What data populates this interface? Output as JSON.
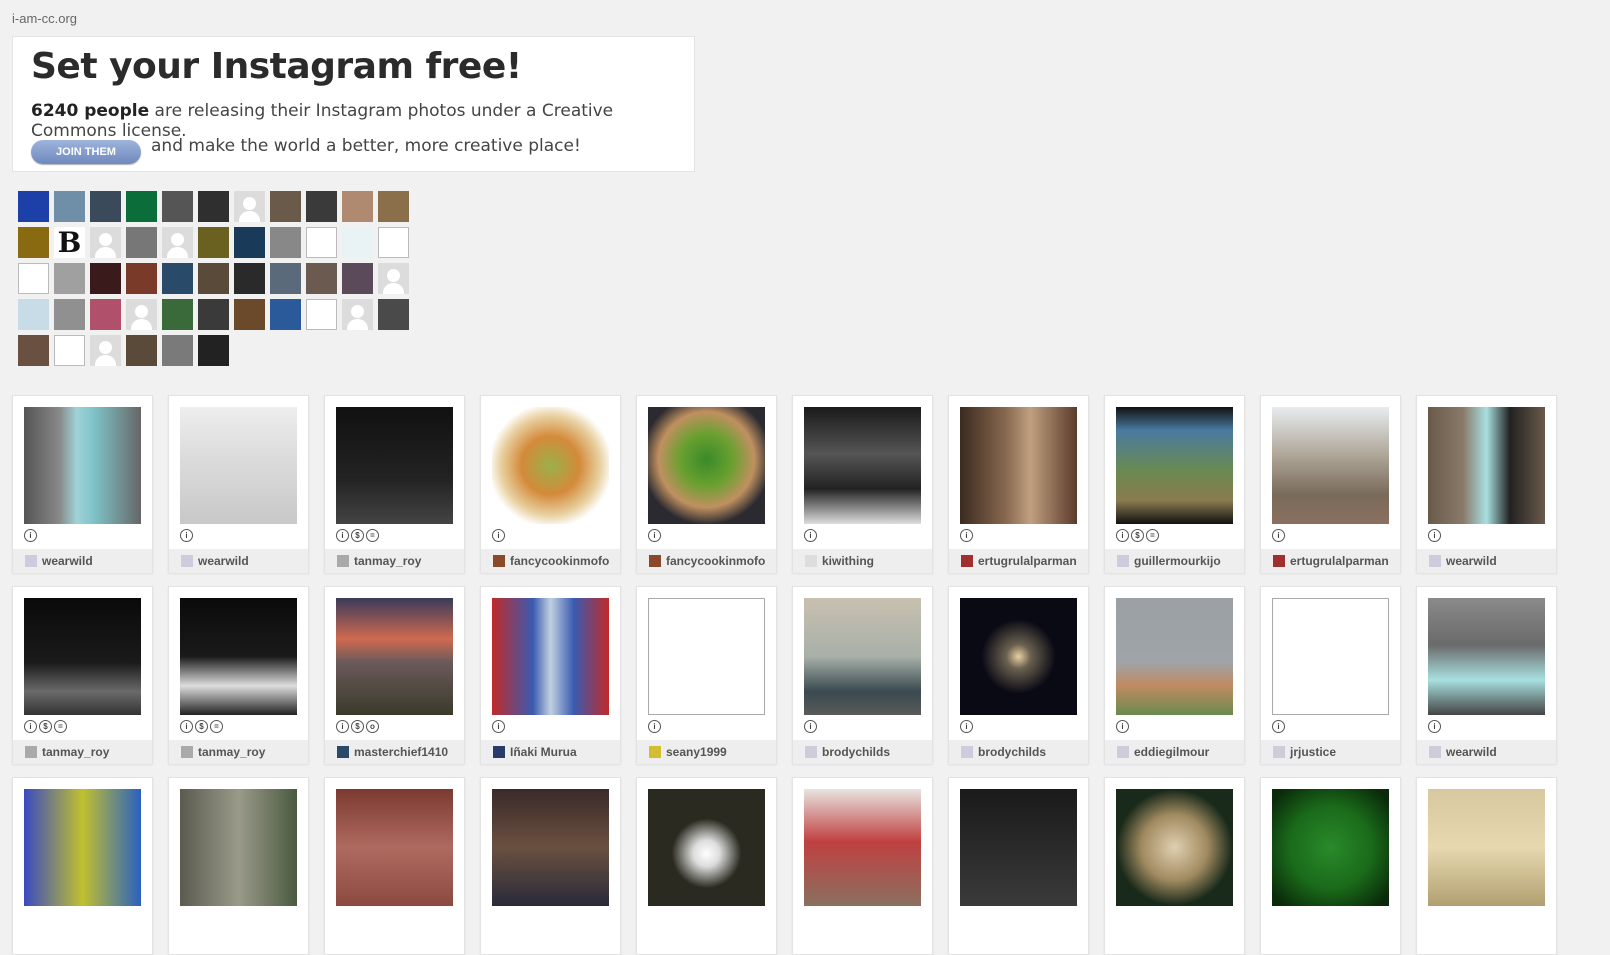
{
  "site": {
    "name": "i-am-cc.org"
  },
  "hero": {
    "title": "Set your Instagram free!",
    "count": "6240 people",
    "line1_rest": " are releasing their Instagram photos under a Creative Commons license.",
    "join_label": "JOIN THEM",
    "line2": "and make the world a better, more creative place!"
  },
  "avatars": [
    {
      "kind": "photo",
      "color": "#1c3fa8"
    },
    {
      "kind": "photo",
      "color": "#6f8fa8"
    },
    {
      "kind": "photo",
      "color": "#3b4a5a"
    },
    {
      "kind": "photo",
      "color": "#0b6e3a"
    },
    {
      "kind": "photo",
      "color": "#555555"
    },
    {
      "kind": "photo",
      "color": "#2f2f2f"
    },
    {
      "kind": "default"
    },
    {
      "kind": "photo",
      "color": "#6a5a4a"
    },
    {
      "kind": "photo",
      "color": "#3a3a3a"
    },
    {
      "kind": "photo",
      "color": "#b08a70"
    },
    {
      "kind": "photo",
      "color": "#8a6f4a"
    },
    {
      "kind": "photo",
      "color": "#8a6a10"
    },
    {
      "kind": "letter",
      "text": "B"
    },
    {
      "kind": "default"
    },
    {
      "kind": "photo",
      "color": "#777777"
    },
    {
      "kind": "default"
    },
    {
      "kind": "photo",
      "color": "#6a6020"
    },
    {
      "kind": "photo",
      "color": "#1a3a5a"
    },
    {
      "kind": "photo",
      "color": "#888888"
    },
    {
      "kind": "broken"
    },
    {
      "kind": "photo",
      "color": "#e9f2f4"
    },
    {
      "kind": "broken"
    },
    {
      "kind": "broken"
    },
    {
      "kind": "photo",
      "color": "#a0a0a0"
    },
    {
      "kind": "photo",
      "color": "#3a1a1a"
    },
    {
      "kind": "photo",
      "color": "#7a3a2a"
    },
    {
      "kind": "photo",
      "color": "#2a4a6a"
    },
    {
      "kind": "photo",
      "color": "#5a4a3a"
    },
    {
      "kind": "photo",
      "color": "#2a2a2a"
    },
    {
      "kind": "photo",
      "color": "#5a6a7a"
    },
    {
      "kind": "photo",
      "color": "#6a5a50"
    },
    {
      "kind": "photo",
      "color": "#5a4a5a"
    },
    {
      "kind": "default"
    },
    {
      "kind": "photo",
      "color": "#c8dce8"
    },
    {
      "kind": "photo",
      "color": "#909090"
    },
    {
      "kind": "photo",
      "color": "#b0506a"
    },
    {
      "kind": "default"
    },
    {
      "kind": "photo",
      "color": "#3a6a3a"
    },
    {
      "kind": "photo",
      "color": "#3a3a3a"
    },
    {
      "kind": "photo",
      "color": "#6a4a2a"
    },
    {
      "kind": "photo",
      "color": "#2a5a9a"
    },
    {
      "kind": "broken"
    },
    {
      "kind": "default"
    },
    {
      "kind": "photo",
      "color": "#4a4a4a"
    },
    {
      "kind": "photo",
      "color": "#6a5040"
    },
    {
      "kind": "broken"
    },
    {
      "kind": "default"
    },
    {
      "kind": "photo",
      "color": "#5a4a3a"
    },
    {
      "kind": "photo",
      "color": "#7a7a7a"
    },
    {
      "kind": "photo",
      "color": "#222222"
    }
  ],
  "photos": [
    {
      "user": "wearwild",
      "license": [
        "i"
      ],
      "bg": "linear-gradient(90deg,#555 0%,#888 30%,#9fd2d6 45%,#7ec3c8 60%,#666 100%)",
      "uav": "#ccd"
    },
    {
      "user": "wearwild",
      "license": [
        "i"
      ],
      "bg": "linear-gradient(#eee,#ddd 40%,#c8c8c8 100%)",
      "uav": "#ccd"
    },
    {
      "user": "tanmay_roy",
      "license": [
        "i",
        "$",
        "="
      ],
      "bg": "linear-gradient(#111,#222 60%,#444)",
      "uav": "#aaa"
    },
    {
      "user": "fancycookinmofo",
      "license": [
        "i"
      ],
      "bg": "radial-gradient(circle at 50% 50%,#9bb04a 0%,#d48a3a 35%,#e8d0a0 60%,#fff 75%)",
      "uav": "#8a4a2a"
    },
    {
      "user": "fancycookinmofo",
      "license": [
        "i"
      ],
      "bg": "radial-gradient(circle at 50% 45%,#3a8a2a 0%,#6aa030 30%,#c09060 55%,#2a2a30 75%)",
      "uav": "#8a4a2a"
    },
    {
      "user": "kiwithing",
      "license": [
        "i"
      ],
      "bg": "linear-gradient(#1a1a1a,#555 40%,#222 70%,#ddd 100%)",
      "uav": "#ddd"
    },
    {
      "user": "ertugrulalparman",
      "license": [
        "i"
      ],
      "bg": "linear-gradient(90deg,#3a2a20,#8a6a50 40%,#c0a080 60%,#5a3a2a)",
      "uav": "#a03030"
    },
    {
      "user": "guillermourkijo",
      "license": [
        "i",
        "$",
        "="
      ],
      "bg": "linear-gradient(#111 0%,#4a7aa0 20%,#6a8a50 55%,#8a7a50 80%,#111 100%)",
      "uav": "#ccd"
    },
    {
      "user": "ertugrulalparman",
      "license": [
        "i"
      ],
      "bg": "linear-gradient(#e8ecf0,#b0a89a 40%,#7a6a5a 75%,#8a7060)",
      "uav": "#a03030"
    },
    {
      "user": "wearwild",
      "license": [
        "i"
      ],
      "bg": "linear-gradient(90deg,#6a5a4a,#8a7a6a 30%,#a8e0e0 50%,#222 70%,#6a5a4a)",
      "uav": "#ccd"
    },
    {
      "user": "tanmay_roy",
      "license": [
        "i",
        "$",
        "="
      ],
      "bg": "linear-gradient(#0a0a0a,#1a1a1a 55%,#6a6a6a 80%,#333)",
      "uav": "#aaa"
    },
    {
      "user": "tanmay_roy",
      "license": [
        "i",
        "$",
        "="
      ],
      "bg": "linear-gradient(#0a0a0a,#1a1a1a 50%,#ddd 75%,#222)",
      "uav": "#aaa"
    },
    {
      "user": "masterchief1410",
      "license": [
        "i",
        "$",
        "o"
      ],
      "bg": "linear-gradient(#3a3a5a,#d06a50 35%,#6a5a5a 55%,#3a3a2a 100%)",
      "uav": "#2a4a6a"
    },
    {
      "user": "Iñaki Murua",
      "license": [
        "i"
      ],
      "bg": "linear-gradient(90deg,#c02a2a,#3a5ab0 35%,#c0d0e0 50%,#3a5ab0 70%,#c02a2a)",
      "uav": "#2a3a6a"
    },
    {
      "user": "seany1999",
      "license": [
        "i"
      ],
      "bg": "broken",
      "uav": "#d0c030"
    },
    {
      "user": "brodychilds",
      "license": [
        "i"
      ],
      "bg": "linear-gradient(#c8c0b0,#a8b0a8 50%,#3a4a50 80%,#5a5a5a)",
      "uav": "#ccd"
    },
    {
      "user": "brodychilds",
      "license": [
        "i"
      ],
      "bg": "radial-gradient(ellipse at 50% 50%,#e8d0a0 0%,#6a6050 15%,#0a0a14 45%)",
      "uav": "#ccd"
    },
    {
      "user": "eddiegilmour",
      "license": [
        "i"
      ],
      "bg": "linear-gradient(#9aa0a4,#a0a4a8 55%,#c08a60 75%,#6a8a50)",
      "uav": "#ccd"
    },
    {
      "user": "jrjustice",
      "license": [
        "i"
      ],
      "bg": "broken",
      "uav": "#ccd"
    },
    {
      "user": "wearwild",
      "license": [
        "i"
      ],
      "bg": "linear-gradient(#8a8a8a,#6a6a6a 40%,#a8e0e0 70%,#444)",
      "uav": "#ccd"
    },
    {
      "user": "",
      "license": [],
      "bg": "linear-gradient(90deg,#3a4ac0,#c0c030 50%,#2a60c0)",
      "uav": ""
    },
    {
      "user": "",
      "license": [],
      "bg": "linear-gradient(90deg,#5a5a50,#9a9a8a 50%,#4a5a40)",
      "uav": ""
    },
    {
      "user": "",
      "license": [],
      "bg": "linear-gradient(#7a3a30,#b06a60 50%,#8a4a40)",
      "uav": ""
    },
    {
      "user": "",
      "license": [],
      "bg": "linear-gradient(#3a2a2a,#6a5040 50%,#2a2a3a)",
      "uav": ""
    },
    {
      "user": "",
      "license": [],
      "bg": "radial-gradient(circle at 50% 55%,#fff 0%,#ddd 15%,#2a2a20 40%)",
      "uav": ""
    },
    {
      "user": "",
      "license": [],
      "bg": "linear-gradient(#e8e4e0,#c04040 45%,#8a7060)",
      "uav": ""
    },
    {
      "user": "",
      "license": [],
      "bg": "linear-gradient(#1a1a1a,#3a3a3a)",
      "uav": ""
    },
    {
      "user": "",
      "license": [],
      "bg": "radial-gradient(circle at 50% 50%,#e0d0b0 0%,#a08a60 40%,#1a2a1a 70%)",
      "uav": ""
    },
    {
      "user": "",
      "license": [],
      "bg": "radial-gradient(circle at 50% 50%,#2a8a2a 0%,#1a6a1a 50%,#0a2a0a 90%)",
      "uav": ""
    },
    {
      "user": "",
      "license": [],
      "bg": "linear-gradient(#d8c8a0,#e8d8b0 50%,#b0a070)",
      "uav": ""
    }
  ]
}
